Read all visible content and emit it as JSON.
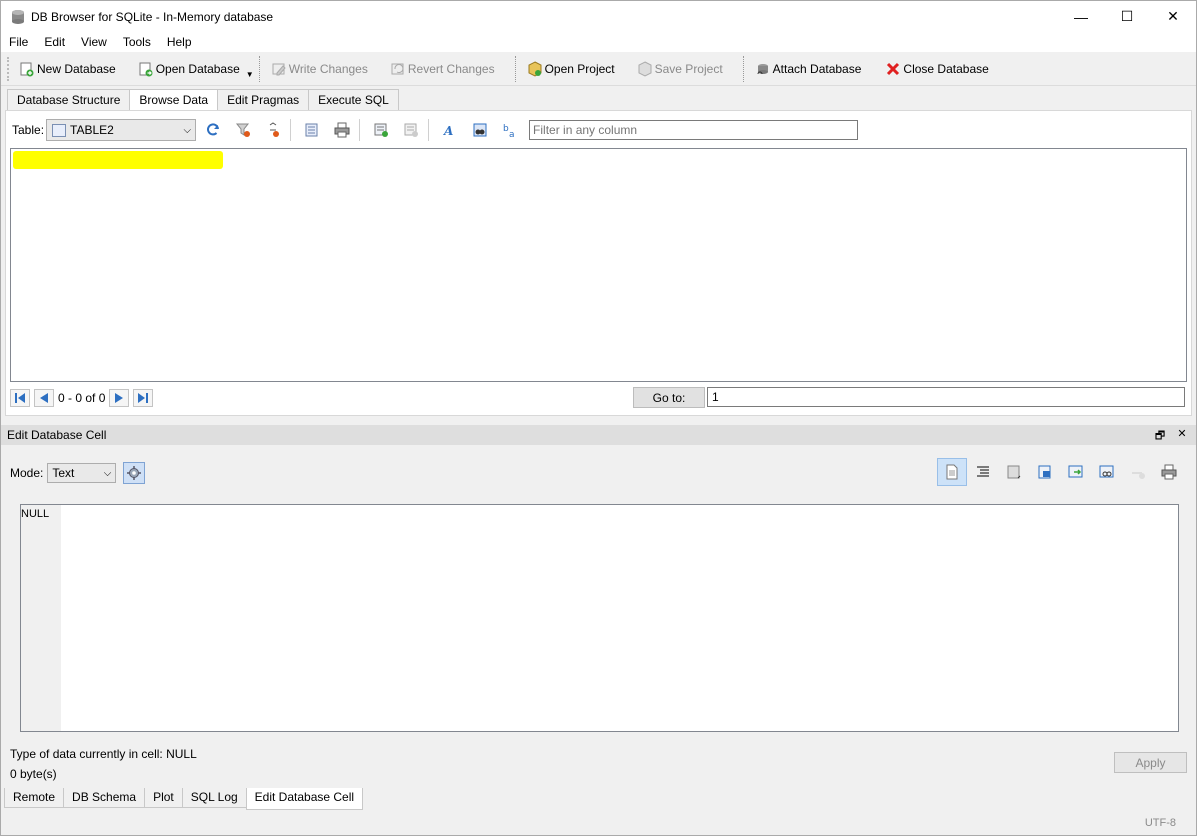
{
  "window": {
    "title": "DB Browser for SQLite - In-Memory database",
    "controls": {
      "minimize": "—",
      "maximize": "☐",
      "close": "✕"
    }
  },
  "menu": [
    "File",
    "Edit",
    "View",
    "Tools",
    "Help"
  ],
  "toolbar": {
    "new_database": "New Database",
    "open_database": "Open Database",
    "write_changes": "Write Changes",
    "revert_changes": "Revert Changes",
    "open_project": "Open Project",
    "save_project": "Save Project",
    "attach_database": "Attach Database",
    "close_database": "Close Database"
  },
  "tabs": [
    "Database Structure",
    "Browse Data",
    "Edit Pragmas",
    "Execute SQL"
  ],
  "browse": {
    "table_label": "Table:",
    "table_value": "TABLE2",
    "filter_placeholder": "Filter in any column",
    "record_count": "0 - 0 of 0",
    "goto_label": "Go to:",
    "goto_value": "1"
  },
  "edit_cell": {
    "panel_title": "Edit Database Cell",
    "mode_label": "Mode:",
    "mode_value": "Text",
    "cell_content": "NULL",
    "type_info": "Type of data currently in cell: NULL",
    "size_info": "0 byte(s)",
    "apply_label": "Apply"
  },
  "bottom_tabs": [
    "Remote",
    "DB Schema",
    "Plot",
    "SQL Log",
    "Edit Database Cell"
  ],
  "status": {
    "encoding": "UTF-8"
  },
  "colors": {
    "highlight": "#ffff00",
    "accent": "#cde2f8",
    "close_red": "#e02020"
  }
}
